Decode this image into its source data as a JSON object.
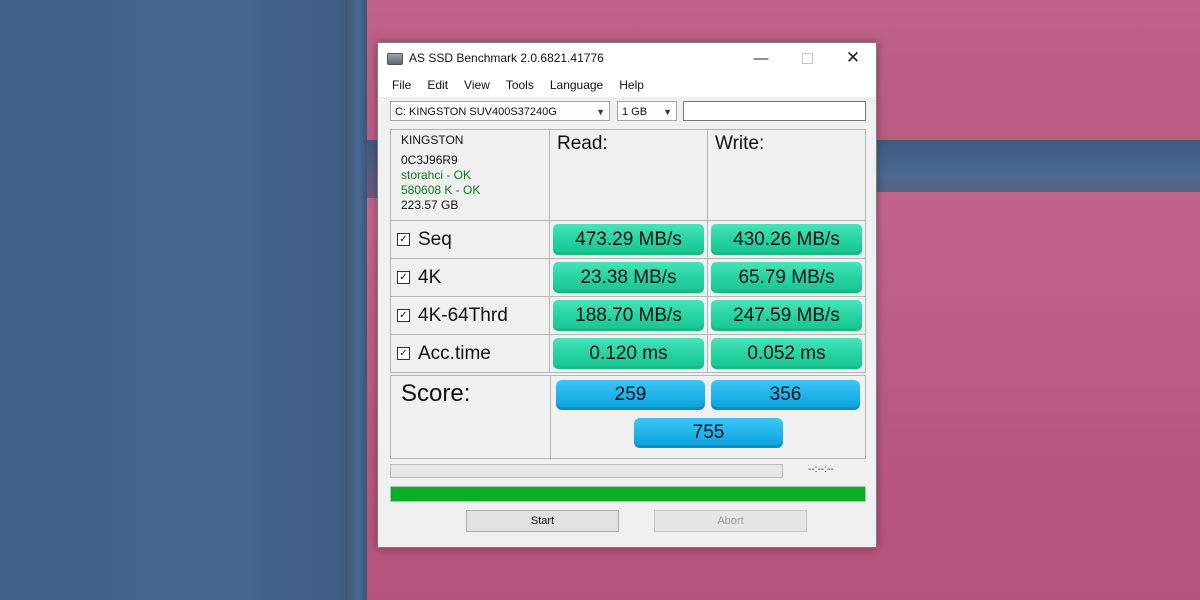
{
  "window": {
    "title": "AS SSD Benchmark 2.0.6821.41776",
    "controls": {
      "minimize": "—",
      "maximize": "□",
      "close": "✕"
    }
  },
  "menu": [
    "File",
    "Edit",
    "View",
    "Tools",
    "Language",
    "Help"
  ],
  "toolbar": {
    "drive": "C: KINGSTON SUV400S37240G",
    "size": "1 GB",
    "text_value": ""
  },
  "drive_info": {
    "vendor": "KINGSTON",
    "firmware": "0C3J96R9",
    "driver_status": "storahci - OK",
    "alignment_status": "580608 K - OK",
    "capacity": "223.57 GB"
  },
  "headers": {
    "read": "Read:",
    "write": "Write:"
  },
  "tests": [
    {
      "label": "Seq",
      "checked": true,
      "read": "473.29 MB/s",
      "write": "430.26 MB/s"
    },
    {
      "label": "4K",
      "checked": true,
      "read": "23.38 MB/s",
      "write": "65.79 MB/s"
    },
    {
      "label": "4K-64Thrd",
      "checked": true,
      "read": "188.70 MB/s",
      "write": "247.59 MB/s"
    },
    {
      "label": "Acc.time",
      "checked": true,
      "read": "0.120 ms",
      "write": "0.052 ms"
    }
  ],
  "score": {
    "label": "Score:",
    "read": "259",
    "write": "356",
    "total": "755"
  },
  "status": {
    "timer": "--:--:--",
    "progress_fraction": 1.0
  },
  "buttons": {
    "start": "Start",
    "abort": "Abort"
  },
  "colors": {
    "result_green": "#27d3a2",
    "score_blue": "#1fb1ea",
    "progress_green": "#06b025"
  }
}
